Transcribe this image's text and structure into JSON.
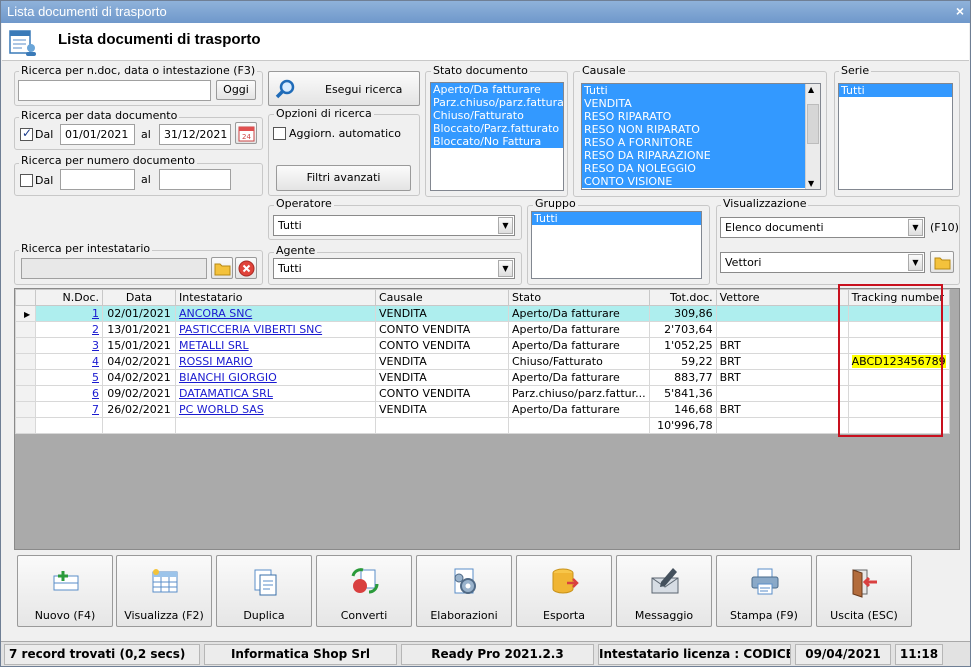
{
  "window": {
    "title": "Lista documenti di trasporto",
    "close": "×"
  },
  "header": {
    "title": "Lista documenti di trasporto"
  },
  "search_text": {
    "legend": "Ricerca per n.doc, data o intestazione (F3)",
    "value": "",
    "oggi": "Oggi"
  },
  "search_btn": "Esegui ricerca",
  "date_search": {
    "legend": "Ricerca per data documento",
    "dal_label": "Dal",
    "checked": true,
    "from": "01/01/2021",
    "al_label": "al",
    "to": "31/12/2021"
  },
  "num_search": {
    "legend": "Ricerca per numero documento",
    "dal_label": "Dal",
    "checked": false,
    "from": "",
    "al_label": "al",
    "to": ""
  },
  "options": {
    "legend": "Opzioni di ricerca",
    "auto_label": "Aggiorn. automatico",
    "filters_btn": "Filtri avanzati"
  },
  "stato": {
    "legend": "Stato documento",
    "items": [
      "Aperto/Da fatturare",
      "Parz.chiuso/parz.fatturato",
      "Chiuso/Fatturato",
      "Bloccato/Parz.fatturato",
      "Bloccato/No Fattura"
    ]
  },
  "causale": {
    "legend": "Causale",
    "items": [
      "Tutti",
      "VENDITA",
      "RESO RIPARATO",
      "RESO NON RIPARATO",
      "RESO A FORNITORE",
      "RESO DA RIPARAZIONE",
      "RESO DA NOLEGGIO",
      "CONTO VISIONE"
    ]
  },
  "serie": {
    "legend": "Serie",
    "items": [
      "Tutti"
    ]
  },
  "operatore": {
    "legend": "Operatore",
    "value": "Tutti"
  },
  "agente": {
    "legend": "Agente",
    "value": "Tutti"
  },
  "gruppo": {
    "legend": "Gruppo",
    "items": [
      "Tutti"
    ]
  },
  "visual": {
    "legend": "Visualizzazione",
    "value": "Elenco documenti",
    "shortcut": "(F10)",
    "vettori": "Vettori"
  },
  "intestatario": {
    "legend": "Ricerca per intestatario",
    "value": ""
  },
  "table": {
    "columns": [
      "N.Doc.",
      "Data",
      "Intestatario",
      "Causale",
      "Stato",
      "Tot.doc.",
      "Vettore",
      "Tracking number"
    ],
    "rows": [
      {
        "n": "1",
        "data": "02/01/2021",
        "int": "ANCORA SNC",
        "causale": "VENDITA",
        "stato": "Aperto/Da fatturare",
        "tot": "309,86",
        "vettore": "",
        "track": ""
      },
      {
        "n": "2",
        "data": "13/01/2021",
        "int": "PASTICCERIA VIBERTI SNC",
        "causale": "CONTO VENDITA",
        "stato": "Aperto/Da fatturare",
        "tot": "2'703,64",
        "vettore": "",
        "track": ""
      },
      {
        "n": "3",
        "data": "15/01/2021",
        "int": "METALLI SRL",
        "causale": "CONTO VENDITA",
        "stato": "Aperto/Da fatturare",
        "tot": "1'052,25",
        "vettore": "BRT",
        "track": ""
      },
      {
        "n": "4",
        "data": "04/02/2021",
        "int": "ROSSI MARIO",
        "causale": "VENDITA",
        "stato": "Chiuso/Fatturato",
        "tot": "59,22",
        "vettore": "BRT",
        "track": "ABCD123456789"
      },
      {
        "n": "5",
        "data": "04/02/2021",
        "int": "BIANCHI GIORGIO",
        "causale": "VENDITA",
        "stato": "Aperto/Da fatturare",
        "tot": "883,77",
        "vettore": "BRT",
        "track": ""
      },
      {
        "n": "6",
        "data": "09/02/2021",
        "int": "DATAMATICA SRL",
        "causale": "CONTO VENDITA",
        "stato": "Parz.chiuso/parz.fattur...",
        "tot": "5'841,36",
        "vettore": "",
        "track": ""
      },
      {
        "n": "7",
        "data": "26/02/2021",
        "int": "PC WORLD SAS",
        "causale": "VENDITA",
        "stato": "Aperto/Da fatturare",
        "tot": "146,68",
        "vettore": "BRT",
        "track": ""
      }
    ],
    "total": "10'996,78"
  },
  "toolbar": [
    "Nuovo (F4)",
    "Visualizza (F2)",
    "Duplica",
    "Converti",
    "Elaborazioni",
    "Esporta",
    "Messaggio",
    "Stampa (F9)",
    "Uscita (ESC)"
  ],
  "status": {
    "records": "7 record trovati (0,2 secs)",
    "company": "Informatica Shop Srl",
    "version": "Ready Pro 2021.2.3",
    "license": "Intestatario licenza : CODICE SRL",
    "date": "09/04/2021",
    "time": "11:18"
  },
  "colors": {
    "selection": "#3399ff",
    "current_row": "#aeeeee",
    "tracking_highlight": "#ffff00",
    "annotation_box": "#c8101e"
  }
}
